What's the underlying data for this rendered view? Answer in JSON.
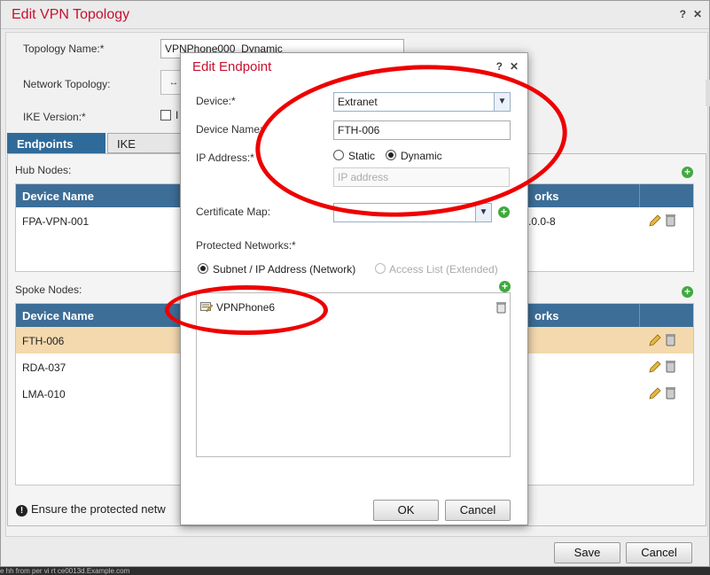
{
  "outer": {
    "title": "Edit VPN Topology",
    "help": "?",
    "close": "✕",
    "topology_name_label": "Topology Name:*",
    "topology_name_value": "VPNPhone000_Dynamic",
    "network_topology_label": "Network Topology:",
    "network_topology_btn": "↔",
    "ike_version_label": "IKE Version:*",
    "ike_checkbox_label": "I",
    "tabs": [
      "Endpoints",
      "IKE"
    ],
    "hub_label": "Hub Nodes:",
    "spoke_label": "Spoke Nodes:",
    "col_device": "Device Name",
    "col_networks": "orks",
    "hub_rows": [
      {
        "device": "FPA-VPN-001",
        "networks": ".0.0-8"
      }
    ],
    "spoke_rows": [
      {
        "device": "FTH-006"
      },
      {
        "device": "RDA-037"
      },
      {
        "device": "LMA-010"
      }
    ],
    "warning": "Ensure the protected netw",
    "save": "Save",
    "cancel": "Cancel",
    "bottom_text": "e hh from per vi rt ce0013d.Example.com"
  },
  "modal": {
    "title": "Edit Endpoint",
    "help": "?",
    "close": "✕",
    "device_label": "Device:*",
    "device_value": "Extranet",
    "device_name_label": "Device Name:*",
    "device_name_value": "FTH-006",
    "ip_label": "IP Address:*",
    "ip_static": "Static",
    "ip_dynamic": "Dynamic",
    "ip_placeholder": "IP address",
    "cert_label": "Certificate Map:",
    "cert_value": "",
    "protected_label": "Protected Networks:*",
    "subnet_option": "Subnet / IP Address (Network)",
    "acl_option": "Access List (Extended)",
    "networks": [
      "VPNPhone6"
    ],
    "ok": "OK",
    "cancel": "Cancel"
  },
  "colors": {
    "title_red": "#c8102e",
    "header_blue": "#3d6e98",
    "tab_blue": "#2f6b9a",
    "selected_row": "#f4d9ae",
    "annotation_red": "#e00000",
    "add_green": "#3faa3f"
  }
}
